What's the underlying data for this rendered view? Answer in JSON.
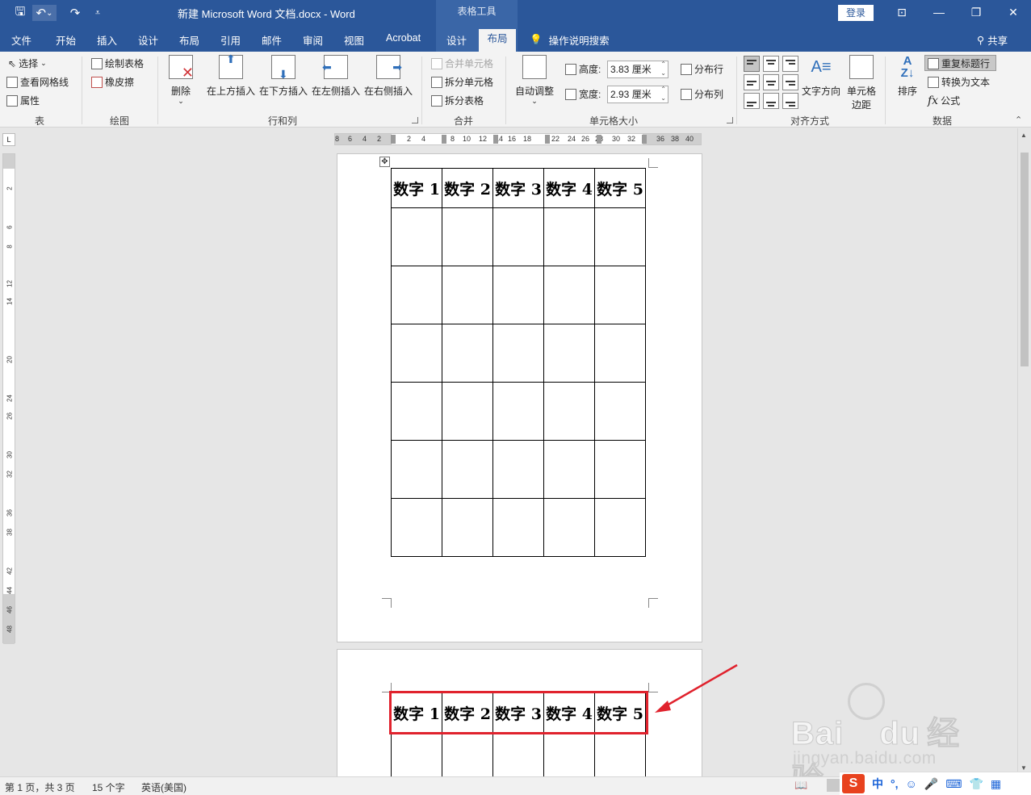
{
  "window": {
    "title": "新建 Microsoft Word 文档.docx  -  Word",
    "context_tools": "表格工具",
    "login": "登录",
    "controls": {
      "ribbon_display": "⊡",
      "minimize": "—",
      "restore": "❐",
      "close": "✕"
    }
  },
  "quick_access": {
    "save": "🖫",
    "undo": "↶",
    "undo_more": "⌄",
    "redo": "↷",
    "customize": "⩡"
  },
  "tabs": [
    "文件",
    "开始",
    "插入",
    "设计",
    "布局",
    "引用",
    "邮件",
    "审阅",
    "视图",
    "Acrobat",
    "设计",
    "布局"
  ],
  "tell_me": "操作说明搜索",
  "share": "共享",
  "ribbon": {
    "table_group": {
      "label": "表",
      "select": "选择",
      "view_gridlines": "查看网格线",
      "properties": "属性"
    },
    "draw_group": {
      "label": "绘图",
      "draw_table": "绘制表格",
      "eraser": "橡皮擦"
    },
    "rows_cols_group": {
      "label": "行和列",
      "delete": "删除",
      "insert_above": "在上方插入",
      "insert_below": "在下方插入",
      "insert_left": "在左侧插入",
      "insert_right": "在右侧插入"
    },
    "merge_group": {
      "label": "合并",
      "merge_cells": "合并单元格",
      "split_cells": "拆分单元格",
      "split_table": "拆分表格"
    },
    "cell_size_group": {
      "label": "单元格大小",
      "autofit": "自动调整",
      "height_label": "高度:",
      "height_value": "3.83 厘米",
      "width_label": "宽度:",
      "width_value": "2.93 厘米",
      "distribute_rows": "分布行",
      "distribute_cols": "分布列"
    },
    "alignment_group": {
      "label": "对齐方式",
      "text_direction": "文字方向",
      "cell_margins_1": "单元格",
      "cell_margins_2": "边距"
    },
    "data_group": {
      "label": "数据",
      "sort": "排序",
      "repeat_header": "重复标题行",
      "convert_to_text": "转换为文本",
      "formula": "公式",
      "fx": "fx"
    }
  },
  "ruler": {
    "h_ticks": [
      "8",
      "6",
      "4",
      "2",
      "2",
      "4",
      "8",
      "10",
      "12",
      "14",
      "16",
      "18",
      "22",
      "24",
      "26",
      "28",
      "30",
      "32",
      "36",
      "38",
      "40"
    ],
    "v_ticks": [
      "2",
      "6",
      "8",
      "12",
      "14",
      "20",
      "24",
      "26",
      "30",
      "32",
      "36",
      "38",
      "42",
      "44",
      "46",
      "48"
    ],
    "corner": "L"
  },
  "table": {
    "headers": [
      "数字 1",
      "数字 2",
      "数字 3",
      "数字 4",
      "数字 5"
    ],
    "move_handle": "✥"
  },
  "status": {
    "page": "第 1 页，共 3 页",
    "words": "15 个字",
    "language": "英语(美国)"
  },
  "ime": {
    "logo": "S",
    "mode": "中",
    "punct": "°,",
    "items": [
      "☺",
      "🎤",
      "⌨",
      "👕",
      "▦"
    ]
  },
  "watermark": {
    "brand": "Bai",
    "brand2": "du",
    "brand3": "经验",
    "url": "jingyan.baidu.com"
  }
}
